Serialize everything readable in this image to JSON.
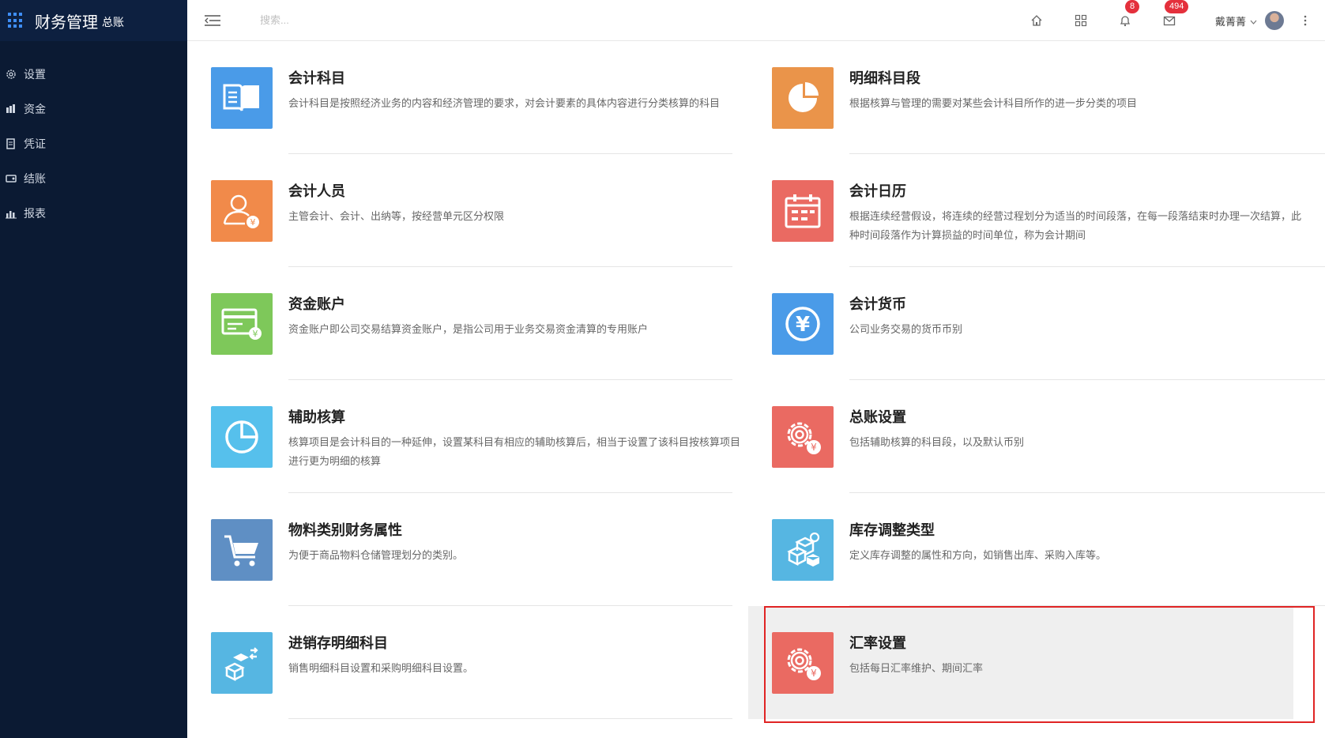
{
  "brand": {
    "title": "财务管理",
    "subtitle": "总账"
  },
  "sidebar": {
    "items": [
      {
        "label": "设置",
        "icon": "gear-icon"
      },
      {
        "label": "资金",
        "icon": "money-icon"
      },
      {
        "label": "凭证",
        "icon": "voucher-icon"
      },
      {
        "label": "结账",
        "icon": "checkout-icon"
      },
      {
        "label": "报表",
        "icon": "chart-icon"
      }
    ]
  },
  "topbar": {
    "search_placeholder": "搜索...",
    "notifications_count": "8",
    "messages_count": "494",
    "user_name": "戴菁菁"
  },
  "colors": {
    "blue": "#4a9be8",
    "orange": "#ea944a",
    "red": "#ea6a62",
    "green": "#7ec85a",
    "skyblue": "#56c0ec",
    "steel": "#5f8fc4"
  },
  "cards": [
    {
      "title": "会计科目",
      "desc": "会计科目是按照经济业务的内容和经济管理的要求，对会计要素的具体内容进行分类核算的科目",
      "icon": "book-icon",
      "color": "#4a9be8"
    },
    {
      "title": "明细科目段",
      "desc": "根据核算与管理的需要对某些会计科目所作的进一步分类的项目",
      "icon": "pie-icon",
      "color": "#ea944a"
    },
    {
      "title": "会计人员",
      "desc": "主管会计、会计、出纳等，按经营单元区分权限",
      "icon": "user-yen-icon",
      "color": "#f18a4a"
    },
    {
      "title": "会计日历",
      "desc": "根据连续经营假设，将连续的经营过程划分为适当的时间段落，在每一段落结束时办理一次结算，此种时间段落作为计算损益的时间单位，称为会计期间",
      "icon": "calendar-icon",
      "color": "#ea6a62"
    },
    {
      "title": "资金账户",
      "desc": "资金账户即公司交易结算资金账户，是指公司用于业务交易资金清算的专用账户",
      "icon": "card-yen-icon",
      "color": "#7ec85a"
    },
    {
      "title": "会计货币",
      "desc": "公司业务交易的货币币别",
      "icon": "yen-circle-icon",
      "color": "#4a9be8"
    },
    {
      "title": "辅助核算",
      "desc": "核算项目是会计科目的一种延伸，设置某科目有相应的辅助核算后，相当于设置了该科目按核算项目进行更为明细的核算",
      "icon": "pie-outline-icon",
      "color": "#56c0ec"
    },
    {
      "title": "总账设置",
      "desc": "包括辅助核算的科目段，以及默认币别",
      "icon": "gear-yen-icon",
      "color": "#ea6a62"
    },
    {
      "title": "物料类别财务属性",
      "desc": "为便于商品物料仓储管理划分的类别。",
      "icon": "cart-icon",
      "color": "#5f8fc4"
    },
    {
      "title": "库存调整类型",
      "desc": "定义库存调整的属性和方向，如销售出库、采购入库等。",
      "icon": "boxes-icon",
      "color": "#56b6e2"
    },
    {
      "title": "进销存明细科目",
      "desc": "销售明细科目设置和采购明细科目设置。",
      "icon": "boxes-arrow-icon",
      "color": "#56b6e2"
    },
    {
      "title": "汇率设置",
      "desc": "包括每日汇率维护、期间汇率",
      "icon": "gear-yen-icon",
      "color": "#ea6a62"
    }
  ]
}
